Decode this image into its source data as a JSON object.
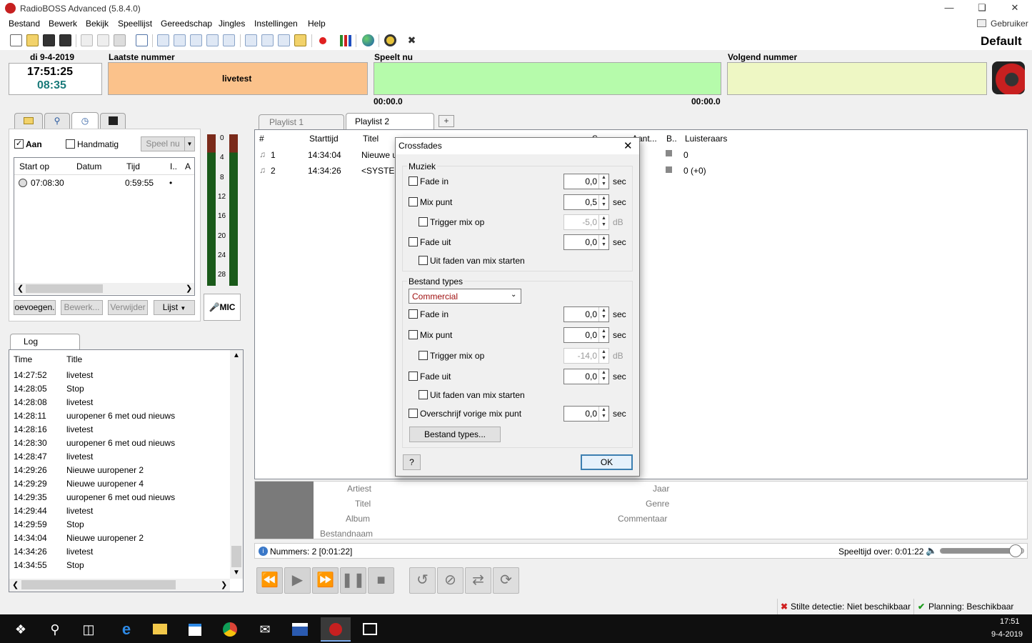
{
  "app": {
    "title": "RadioBOSS Advanced (5.8.4.0)",
    "user": "Gebruiker",
    "profile": "Default"
  },
  "menu": [
    "Bestand",
    "Bewerk",
    "Bekijk",
    "Speellijst",
    "Gereedschap",
    "Jingles",
    "Instellingen",
    "Help"
  ],
  "clock": {
    "date": "di 9-4-2019",
    "time": "17:51:25",
    "countdown": "08:35"
  },
  "tracks": {
    "last_label": "Laatste nummer",
    "last_value": "livetest",
    "now_label": "Speelt nu",
    "now_time_left": "00:00.0",
    "now_time_right": "00:00.0",
    "next_label": "Volgend nummer"
  },
  "scheduler": {
    "on_label": "Aan",
    "manual_label": "Handmatig",
    "play_now": "Speel nu",
    "columns": [
      "Start op",
      "Datum",
      "Tijd",
      "I..",
      "A"
    ],
    "row": {
      "start": "07:08:30",
      "date": "",
      "time": "0:59:55",
      "flag": "•"
    },
    "btn_add": "oevoegen.",
    "btn_edit": "Bewerk...",
    "btn_delete": "Verwijder",
    "btn_list": "Lijst"
  },
  "vu": {
    "scale": [
      "0",
      "4",
      "8",
      "12",
      "16",
      "20",
      "24",
      "28"
    ],
    "mic": "MIC"
  },
  "log": {
    "tab": "Log",
    "columns": [
      "Time",
      "Title"
    ],
    "rows": [
      {
        "time": "14:27:52",
        "title": "livetest"
      },
      {
        "time": "14:28:05",
        "title": "Stop"
      },
      {
        "time": "14:28:08",
        "title": "livetest"
      },
      {
        "time": "14:28:11",
        "title": "uuropener 6 met oud nieuws"
      },
      {
        "time": "14:28:16",
        "title": "livetest"
      },
      {
        "time": "14:28:30",
        "title": "uuropener 6 met oud nieuws"
      },
      {
        "time": "14:28:47",
        "title": "livetest"
      },
      {
        "time": "14:29:26",
        "title": "Nieuwe uuropener 2"
      },
      {
        "time": "14:29:29",
        "title": "Nieuwe uuropener 4"
      },
      {
        "time": "14:29:35",
        "title": "uuropener 6 met oud nieuws"
      },
      {
        "time": "14:29:44",
        "title": "livetest"
      },
      {
        "time": "14:29:59",
        "title": "Stop"
      },
      {
        "time": "14:34:04",
        "title": "Nieuwe uuropener 2"
      },
      {
        "time": "14:34:26",
        "title": "livetest"
      },
      {
        "time": "14:34:55",
        "title": "Stop"
      }
    ]
  },
  "playlist": {
    "tabs": [
      "Playlist 1",
      "Playlist 2"
    ],
    "columns": {
      "num": "#",
      "start": "Starttijd",
      "title": "Titel",
      "c4": "S",
      "c5": "Aant...",
      "c6": "B..",
      "listeners": "Luisteraars"
    },
    "rows": [
      {
        "num": "1",
        "start": "14:34:04",
        "title": "Nieuwe u",
        "listeners": "0"
      },
      {
        "num": "2",
        "start": "14:34:26",
        "title": "<SYSTEM",
        "listeners": "0 (+0)"
      }
    ]
  },
  "info": {
    "artist": "Artiest",
    "title": "Titel",
    "album": "Album",
    "filename": "Bestandnaam",
    "year": "Jaar",
    "genre": "Genre",
    "comment": "Commentaar"
  },
  "status": {
    "tracks": "Nummers: 2 [0:01:22]",
    "remaining": "Speeltijd over: 0:01:22",
    "volume": 0.9
  },
  "bottom": {
    "silence": "Stilte detectie: Niet beschikbaar",
    "planning": "Planning: Beschikbaar"
  },
  "taskbar": {
    "time": "17:51",
    "date": "9-4-2019"
  },
  "dialog": {
    "title": "Crossfades",
    "music_group": "Muziek",
    "fade_in": "Fade in",
    "mix_point": "Mix punt",
    "trigger": "Trigger mix op",
    "fade_out": "Fade uit",
    "fade_from_mix": "Uit faden van mix starten",
    "sec": "sec",
    "db": "dB",
    "m_fadein": "0,0",
    "m_mix": "0,5",
    "m_trigger": "-5,0",
    "m_fadeout": "0,0",
    "types_group": "Bestand types",
    "type_selected": "Commercial",
    "t_fadein": "0,0",
    "t_mix": "0,0",
    "t_trigger": "-14,0",
    "t_fadeout": "0,0",
    "overwrite": "Overschrijf vorige mix punt",
    "t_overwrite": "0,0",
    "types_btn": "Bestand types...",
    "help": "?",
    "ok": "OK"
  }
}
